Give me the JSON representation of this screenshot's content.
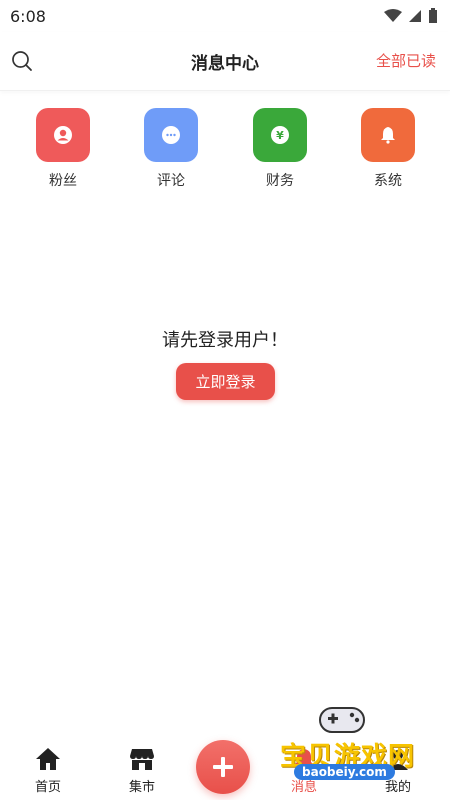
{
  "status_bar": {
    "time": "6:08"
  },
  "header": {
    "title": "消息中心",
    "read_all": "全部已读"
  },
  "categories": [
    {
      "label": "粉丝",
      "color": "#ef5a5a",
      "icon": "user-icon"
    },
    {
      "label": "评论",
      "color": "#6f9cf8",
      "icon": "chat-icon"
    },
    {
      "label": "财务",
      "color": "#3aa83a",
      "icon": "yen-icon"
    },
    {
      "label": "系统",
      "color": "#f06a3c",
      "icon": "bell-icon"
    }
  ],
  "empty_state": {
    "message": "请先登录用户！",
    "login_button": "立即登录"
  },
  "tabbar": {
    "items": [
      {
        "label": "首页",
        "icon": "home-icon"
      },
      {
        "label": "集市",
        "icon": "market-icon"
      },
      {
        "label": "消息",
        "icon": "message-icon"
      },
      {
        "label": "我的",
        "icon": "profile-icon"
      }
    ],
    "add_icon": "plus-icon"
  },
  "watermark": {
    "text": "宝贝游戏网",
    "url": "baobeiy.com"
  },
  "colors": {
    "accent": "#e8504a"
  }
}
